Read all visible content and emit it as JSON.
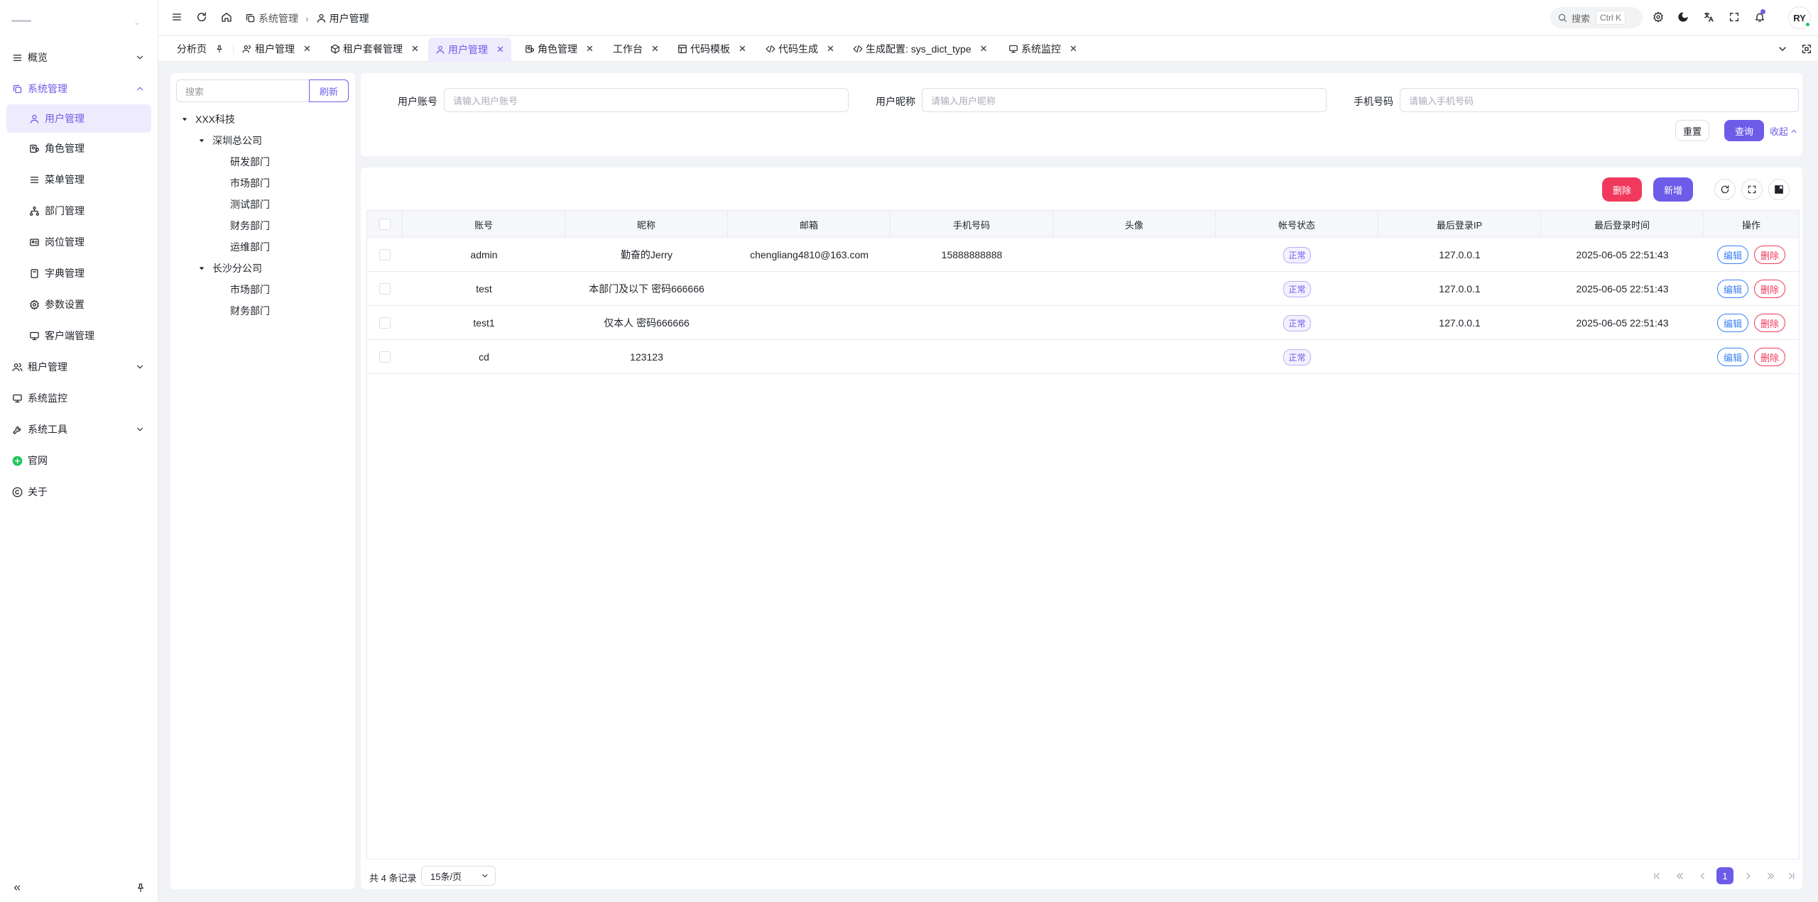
{
  "sidebar": {
    "items": [
      {
        "label": "概览"
      },
      {
        "label": "系统管理"
      },
      {
        "label": "用户管理"
      },
      {
        "label": "角色管理"
      },
      {
        "label": "菜单管理"
      },
      {
        "label": "部门管理"
      },
      {
        "label": "岗位管理"
      },
      {
        "label": "字典管理"
      },
      {
        "label": "参数设置"
      },
      {
        "label": "客户端管理"
      },
      {
        "label": "租户管理"
      },
      {
        "label": "系统监控"
      },
      {
        "label": "系统工具"
      },
      {
        "label": "官网"
      },
      {
        "label": "关于"
      }
    ]
  },
  "header": {
    "breadcrumb": [
      "系统管理",
      "用户管理"
    ],
    "search_label": "搜索",
    "search_shortcut": "Ctrl K",
    "avatar_text": "RY"
  },
  "tabs": [
    {
      "label": "分析页"
    },
    {
      "label": "租户管理"
    },
    {
      "label": "租户套餐管理"
    },
    {
      "label": "用户管理"
    },
    {
      "label": "角色管理"
    },
    {
      "label": "工作台"
    },
    {
      "label": "代码模板"
    },
    {
      "label": "代码生成"
    },
    {
      "label": "生成配置: sys_dict_type"
    },
    {
      "label": "系统监控"
    }
  ],
  "tree": {
    "search_placeholder": "搜索",
    "refresh_label": "刷新",
    "nodes": [
      "XXX科技",
      "深圳总公司",
      "研发部门",
      "市场部门",
      "测试部门",
      "财务部门",
      "运维部门",
      "长沙分公司",
      "市场部门",
      "财务部门"
    ]
  },
  "filters": {
    "account_label": "用户账号",
    "account_placeholder": "请输入用户账号",
    "nickname_label": "用户昵称",
    "nickname_placeholder": "请输入用户昵称",
    "phone_label": "手机号码",
    "phone_placeholder": "请输入手机号码",
    "reset_label": "重置",
    "query_label": "查询",
    "collapse_label": "收起"
  },
  "toolbar": {
    "delete_label": "删除",
    "add_label": "新增"
  },
  "table": {
    "columns": [
      "账号",
      "昵称",
      "邮箱",
      "手机号码",
      "头像",
      "帐号状态",
      "最后登录IP",
      "最后登录时间",
      "操作"
    ],
    "rows": [
      {
        "account": "admin",
        "nickname": "勤奋的Jerry",
        "email": "chengliang4810@163.com",
        "phone": "15888888888",
        "status": "正常",
        "ip": "127.0.0.1",
        "time": "2025-06-05 22:51:43"
      },
      {
        "account": "test",
        "nickname": "本部门及以下 密码666666",
        "email": "",
        "phone": "",
        "status": "正常",
        "ip": "127.0.0.1",
        "time": "2025-06-05 22:51:43"
      },
      {
        "account": "test1",
        "nickname": "仅本人 密码666666",
        "email": "",
        "phone": "",
        "status": "正常",
        "ip": "127.0.0.1",
        "time": "2025-06-05 22:51:43"
      },
      {
        "account": "cd",
        "nickname": "123123",
        "email": "",
        "phone": "",
        "status": "正常",
        "ip": "",
        "time": ""
      }
    ],
    "edit_label": "编辑",
    "delete_label": "删除"
  },
  "pager": {
    "total": "共 4 条记录",
    "page_size": "15条/页",
    "current_page": "1"
  },
  "colors": {
    "primary": "#6d5ce8",
    "danger": "#f0395c",
    "edit": "#3b82f6"
  }
}
